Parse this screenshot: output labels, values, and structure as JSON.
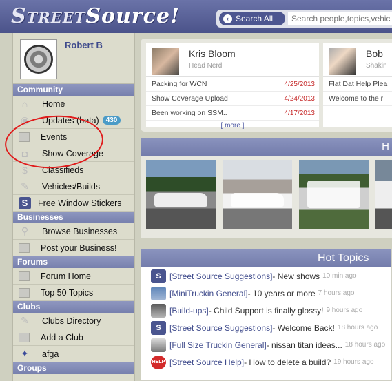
{
  "header": {
    "logo_part1": "Street",
    "logo_part2": "Source!",
    "search_button_label": "Search All",
    "search_placeholder": "Search people,topics,vehic"
  },
  "sidebar": {
    "username": "Robert B",
    "sections": {
      "community": "Community",
      "businesses": "Businesses",
      "forums": "Forums",
      "clubs": "Clubs",
      "groups": "Groups"
    },
    "community_items": [
      {
        "label": "Home",
        "icon": "home-icon"
      },
      {
        "label": "Updates (beta)",
        "icon": "globe-icon",
        "badge": "430"
      },
      {
        "label": "Events",
        "icon": "calendar-icon"
      },
      {
        "label": "Show Coverage",
        "icon": "camera-icon"
      },
      {
        "label": "Classifieds",
        "icon": "dollar-icon"
      },
      {
        "label": "Vehicles/Builds",
        "icon": "wrench-icon"
      },
      {
        "label": "Free Window Stickers",
        "icon": "streetsource-icon"
      }
    ],
    "business_items": [
      {
        "label": "Browse Businesses",
        "icon": "search-icon"
      },
      {
        "label": "Post your Business!",
        "icon": "plus-icon"
      }
    ],
    "forum_items": [
      {
        "label": "Forum Home",
        "icon": "monitor-icon"
      },
      {
        "label": "Top 50 Topics",
        "icon": "monitor-icon"
      }
    ],
    "club_items": [
      {
        "label": "Clubs Directory",
        "icon": "wrench-icon"
      },
      {
        "label": "Add a Club",
        "icon": "plus-icon"
      },
      {
        "label": "afga",
        "icon": "club-logo-icon"
      }
    ]
  },
  "staff_cards": [
    {
      "name": "Kris Bloom",
      "role": "Head Nerd",
      "posts": [
        {
          "title": "Packing for WCN",
          "date": "4/25/2013"
        },
        {
          "title": "Show Coverage Upload",
          "date": "4/24/2013"
        },
        {
          "title": "Been working on SSM..",
          "date": "4/17/2013"
        }
      ],
      "more_label": "[ more ]"
    },
    {
      "name": "Bob",
      "role": "Shakin",
      "posts": [
        {
          "title": "Flat Dat Help Plea"
        },
        {
          "title": "Welcome to the r"
        }
      ]
    }
  ],
  "photos": {
    "heading": "H"
  },
  "hot_topics": {
    "heading": "Hot Topics",
    "items": [
      {
        "forum": "[Street Source Suggestions]",
        "title": " - New shows",
        "ago": "10 min ago",
        "icon": "s"
      },
      {
        "forum": "[MiniTruckin General]",
        "title": " - 10 years or more",
        "ago": "7 hours ago",
        "icon": "car"
      },
      {
        "forum": "[Build-ups]",
        "title": " - Child Support is finally glossy!",
        "ago": "9 hours ago",
        "icon": "build"
      },
      {
        "forum": "[Street Source Suggestions]",
        "title": " - Welcome Back!",
        "ago": "18 hours ago",
        "icon": "s"
      },
      {
        "forum": "[Full Size Truckin General]",
        "title": " - nissan titan ideas...",
        "ago": "18 hours ago",
        "icon": "truck"
      },
      {
        "forum": "[Street Source Help]",
        "title": " - How to delete a build?",
        "ago": "19 hours ago",
        "icon": "help"
      }
    ]
  },
  "colors": {
    "header": "#4b538a",
    "sidebar_bg": "#dcdccc",
    "section_header": "#7780ad",
    "annotation": "#e01b1b",
    "badge": "#4b9bc7"
  }
}
